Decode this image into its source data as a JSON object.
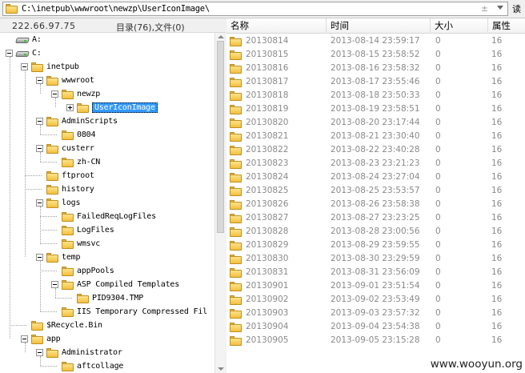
{
  "path_bar": {
    "path": "C:\\inetpub\\wwwroot\\newzp\\UserIconImage\\",
    "plus_minus": "±",
    "right_cut_text": "读"
  },
  "left_panel": {
    "ip_address": "222.66.97.75",
    "dir_count": "目录(76),文件(0)",
    "tree": [
      {
        "label": "A:",
        "icon": "drive-icon",
        "level": 0,
        "toggle": "none"
      },
      {
        "label": "C:",
        "icon": "drive-icon",
        "level": 0,
        "toggle": "minus"
      },
      {
        "label": "inetpub",
        "icon": "folder-icon",
        "level": 1,
        "toggle": "minus"
      },
      {
        "label": "wwwroot",
        "icon": "folder-icon",
        "level": 2,
        "toggle": "minus"
      },
      {
        "label": "newzp",
        "icon": "folder-icon",
        "level": 3,
        "toggle": "minus"
      },
      {
        "label": "UserIconImage",
        "icon": "folder-icon",
        "level": 4,
        "toggle": "plus",
        "selected": true
      },
      {
        "label": "AdminScripts",
        "icon": "folder-icon",
        "level": 2,
        "toggle": "minus"
      },
      {
        "label": "0804",
        "icon": "folder-icon",
        "level": 3,
        "toggle": "none"
      },
      {
        "label": "custerr",
        "icon": "folder-icon",
        "level": 2,
        "toggle": "minus"
      },
      {
        "label": "zh-CN",
        "icon": "folder-icon",
        "level": 3,
        "toggle": "none"
      },
      {
        "label": "ftproot",
        "icon": "folder-icon",
        "level": 2,
        "toggle": "none"
      },
      {
        "label": "history",
        "icon": "folder-icon",
        "level": 2,
        "toggle": "none"
      },
      {
        "label": "logs",
        "icon": "folder-icon",
        "level": 2,
        "toggle": "minus"
      },
      {
        "label": "FailedReqLogFiles",
        "icon": "folder-icon",
        "level": 3,
        "toggle": "none"
      },
      {
        "label": "LogFiles",
        "icon": "folder-icon",
        "level": 3,
        "toggle": "none"
      },
      {
        "label": "wmsvc",
        "icon": "folder-icon",
        "level": 3,
        "toggle": "none"
      },
      {
        "label": "temp",
        "icon": "folder-icon",
        "level": 2,
        "toggle": "minus"
      },
      {
        "label": "appPools",
        "icon": "folder-icon",
        "level": 3,
        "toggle": "none"
      },
      {
        "label": "ASP Compiled Templates",
        "icon": "folder-icon",
        "level": 3,
        "toggle": "minus"
      },
      {
        "label": "PID9304.TMP",
        "icon": "folder-icon",
        "level": 4,
        "toggle": "none"
      },
      {
        "label": "IIS Temporary Compressed Fil",
        "icon": "folder-icon",
        "level": 3,
        "toggle": "none"
      },
      {
        "label": "$Recycle.Bin",
        "icon": "folder-icon",
        "level": 1,
        "toggle": "none"
      },
      {
        "label": "app",
        "icon": "folder-icon",
        "level": 1,
        "toggle": "minus"
      },
      {
        "label": "Administrator",
        "icon": "folder-icon",
        "level": 2,
        "toggle": "minus"
      },
      {
        "label": "aftcollage",
        "icon": "folder-icon",
        "level": 3,
        "toggle": "none"
      }
    ]
  },
  "file_list": {
    "headers": {
      "name": "名称",
      "time": "时间",
      "size": "大小",
      "attr": "属性"
    },
    "rows": [
      {
        "name": "20130814",
        "time": "2013-08-14 23:59:17",
        "size": "0",
        "attr": "16"
      },
      {
        "name": "20130815",
        "time": "2013-08-15 23:58:52",
        "size": "0",
        "attr": "16"
      },
      {
        "name": "20130816",
        "time": "2013-08-16 23:58:32",
        "size": "0",
        "attr": "16"
      },
      {
        "name": "20130817",
        "time": "2013-08-17 23:55:46",
        "size": "0",
        "attr": "16"
      },
      {
        "name": "20130818",
        "time": "2013-08-18 23:50:33",
        "size": "0",
        "attr": "16"
      },
      {
        "name": "20130819",
        "time": "2013-08-19 23:58:51",
        "size": "0",
        "attr": "16"
      },
      {
        "name": "20130820",
        "time": "2013-08-20 23:17:44",
        "size": "0",
        "attr": "16"
      },
      {
        "name": "20130821",
        "time": "2013-08-21 23:30:40",
        "size": "0",
        "attr": "16"
      },
      {
        "name": "20130822",
        "time": "2013-08-22 23:40:28",
        "size": "0",
        "attr": "16"
      },
      {
        "name": "20130823",
        "time": "2013-08-23 23:21:23",
        "size": "0",
        "attr": "16"
      },
      {
        "name": "20130824",
        "time": "2013-08-24 23:27:04",
        "size": "0",
        "attr": "16"
      },
      {
        "name": "20130825",
        "time": "2013-08-25 23:53:57",
        "size": "0",
        "attr": "16"
      },
      {
        "name": "20130826",
        "time": "2013-08-26 23:58:38",
        "size": "0",
        "attr": "16"
      },
      {
        "name": "20130827",
        "time": "2013-08-27 23:23:25",
        "size": "0",
        "attr": "16"
      },
      {
        "name": "20130828",
        "time": "2013-08-28 23:00:56",
        "size": "0",
        "attr": "16"
      },
      {
        "name": "20130829",
        "time": "2013-08-29 23:59:55",
        "size": "0",
        "attr": "16"
      },
      {
        "name": "20130830",
        "time": "2013-08-30 23:29:59",
        "size": "0",
        "attr": "16"
      },
      {
        "name": "20130831",
        "time": "2013-08-31 23:56:09",
        "size": "0",
        "attr": "16"
      },
      {
        "name": "20130901",
        "time": "2013-09-01 23:51:54",
        "size": "0",
        "attr": "16"
      },
      {
        "name": "20130902",
        "time": "2013-09-02 23:53:49",
        "size": "0",
        "attr": "16"
      },
      {
        "name": "20130903",
        "time": "2013-09-03 23:57:32",
        "size": "0",
        "attr": "16"
      },
      {
        "name": "20130904",
        "time": "2013-09-04 23:54:38",
        "size": "0",
        "attr": "16"
      },
      {
        "name": "20130905",
        "time": "2013-09-05 23:15:28",
        "size": "0",
        "attr": "16"
      }
    ]
  },
  "watermark": "www.wooyun.org",
  "colors": {
    "selection": "#3399ff",
    "folder": "#f2c040",
    "list_text": "#8a8a8a"
  }
}
